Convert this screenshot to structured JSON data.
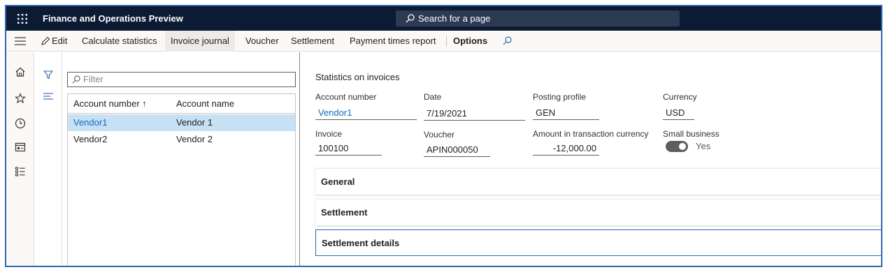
{
  "app": {
    "title": "Finance and Operations Preview"
  },
  "search": {
    "placeholder": "Search for a page"
  },
  "actionbar": {
    "edit": "Edit",
    "calculate_statistics": "Calculate statistics",
    "invoice_journal": "Invoice journal",
    "voucher": "Voucher",
    "settlement": "Settlement",
    "payment_times_report": "Payment times report",
    "options": "Options"
  },
  "list": {
    "filter_placeholder": "Filter",
    "columns": [
      "Account number ↑",
      "Account name"
    ],
    "rows": [
      {
        "account_number": "Vendor1",
        "account_name": "Vendor 1",
        "selected": true
      },
      {
        "account_number": "Vendor2",
        "account_name": "Vendor 2",
        "selected": false
      }
    ]
  },
  "detail": {
    "section_title": "Statistics on invoices",
    "fields": {
      "account_number": {
        "label": "Account number",
        "value": "Vendor1"
      },
      "date": {
        "label": "Date",
        "value": "7/19/2021"
      },
      "posting_profile": {
        "label": "Posting profile",
        "value": "GEN"
      },
      "currency": {
        "label": "Currency",
        "value": "USD"
      },
      "invoice": {
        "label": "Invoice",
        "value": "100100"
      },
      "voucher": {
        "label": "Voucher",
        "value": "APIN000050"
      },
      "amount": {
        "label": "Amount in transaction currency",
        "value": "-12,000.00"
      },
      "small_business": {
        "label": "Small business",
        "value": "Yes"
      }
    },
    "fasttabs": [
      "General",
      "Settlement",
      "Settlement details"
    ]
  },
  "colors": {
    "topbar": "#0b1b33",
    "accent": "#0f6cbd",
    "selection": "#c7e0f4"
  },
  "icons": [
    "waffle-icon",
    "search-icon",
    "hamburger-icon",
    "edit-icon",
    "home-icon",
    "star-icon",
    "clock-icon",
    "workspace-icon",
    "modules-icon",
    "filter-icon",
    "list-icon"
  ]
}
